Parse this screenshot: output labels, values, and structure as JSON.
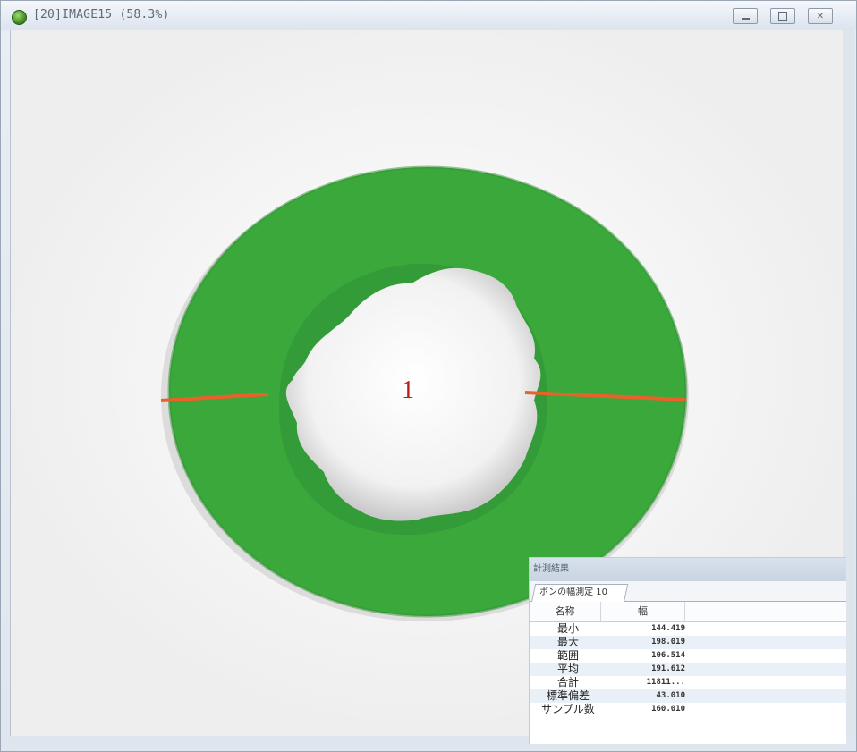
{
  "window": {
    "title": "[20]IMAGE15 (58.3%)",
    "controls": {
      "minimize": "minimize",
      "maximize": "maximize",
      "close": "close"
    }
  },
  "image": {
    "object_label": "1",
    "colors": {
      "ring": "#3aa83a",
      "measure_line": "#e8622a",
      "label": "#c0191b",
      "background": "#f7f7f7"
    }
  },
  "results_panel": {
    "title": "計測結果",
    "tab_label": "ポンの幅測定 10",
    "columns": {
      "name": "名称",
      "width": "幅"
    },
    "rows": [
      {
        "name": "最小",
        "value": "144.419"
      },
      {
        "name": "最大",
        "value": "198.019"
      },
      {
        "name": "範囲",
        "value": "106.514"
      },
      {
        "name": "平均",
        "value": "191.612"
      },
      {
        "name": "合計",
        "value": "11811..."
      },
      {
        "name": "標準偏差",
        "value": "43.010"
      },
      {
        "name": "サンプル数",
        "value": "160.010"
      }
    ]
  }
}
